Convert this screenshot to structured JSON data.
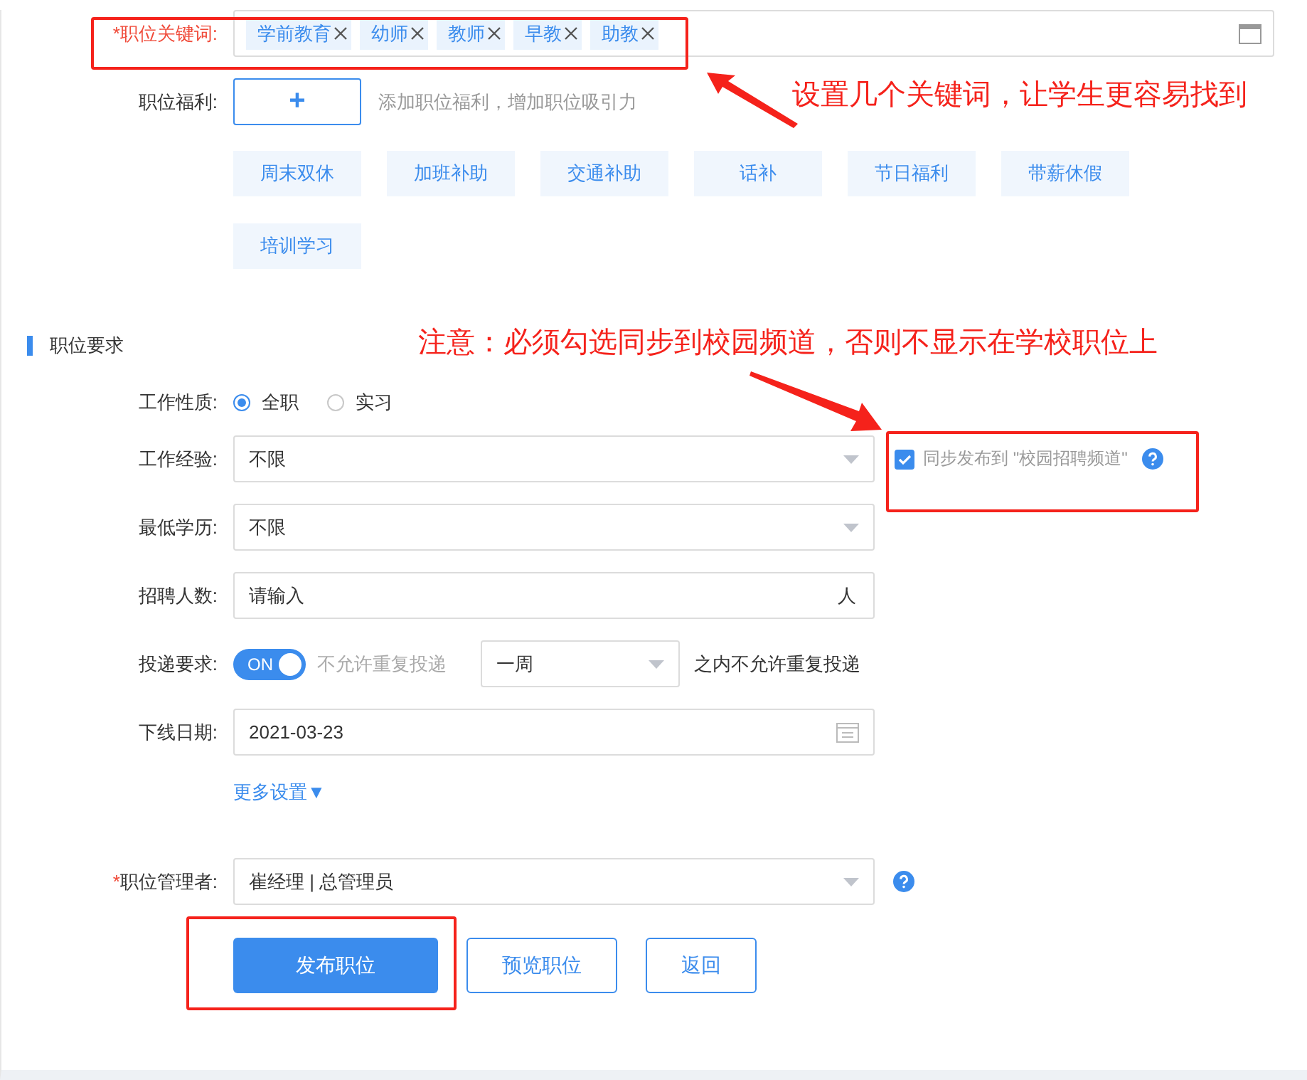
{
  "keywords": {
    "mark": "*",
    "label": "职位关键词:",
    "error": true,
    "tags": [
      {
        "text": "学前教育"
      },
      {
        "text": "幼师"
      },
      {
        "text": "教师"
      },
      {
        "text": "早教"
      },
      {
        "text": "助教"
      }
    ]
  },
  "welfare": {
    "label": "职位福利:",
    "add": "+",
    "hint": "添加职位福利，增加职位吸引力",
    "options": [
      {
        "text": "周末双休"
      },
      {
        "text": "加班补助"
      },
      {
        "text": "交通补助"
      },
      {
        "text": "话补"
      },
      {
        "text": "节日福利"
      },
      {
        "text": "带薪休假"
      },
      {
        "text": "培训学习"
      }
    ]
  },
  "section": {
    "title": "职位要求"
  },
  "fields": [
    {
      "kind": "radio",
      "label": "工作性质:",
      "options": [
        {
          "text": "全职",
          "selected": true
        },
        {
          "text": "实习",
          "selected": false
        }
      ]
    },
    {
      "kind": "select",
      "label": "工作经验:",
      "value": "不限",
      "sync": {
        "checked": true,
        "label": "同步发布到 \"校园招聘频道\""
      }
    },
    {
      "kind": "select",
      "label": "最低学历:",
      "value": "不限"
    },
    {
      "kind": "input",
      "label": "招聘人数:",
      "placeholder": "请输入",
      "suffix": "人"
    },
    {
      "kind": "toggle",
      "label": "投递要求:",
      "on": true,
      "toggle_text": "ON",
      "note": "不允许重复投递",
      "value": "一周",
      "suffix": "之内不允许重复投递"
    },
    {
      "kind": "date",
      "label": "下线日期:",
      "value": "2021-03-23"
    },
    {
      "kind": "link",
      "text": "更多设置▼"
    },
    {
      "kind": "select",
      "mark": "*",
      "label": "职位管理者:",
      "value": "崔经理 | 总管理员",
      "help": true
    }
  ],
  "buttons": [
    {
      "text": "发布职位",
      "primary": true
    },
    {
      "text": "预览职位",
      "primary": false
    },
    {
      "text": "返回",
      "primary": false
    }
  ],
  "annotations": [
    {
      "text": "设置几个关键词，让学生更容易找到"
    },
    {
      "text": "注意：必须勾选同步到校园频道，否则不显示在学校职位上"
    }
  ]
}
